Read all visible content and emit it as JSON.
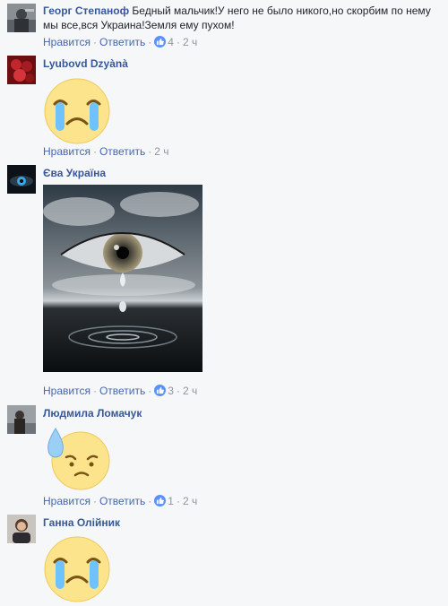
{
  "comments": [
    {
      "author": "Георг Степаноф",
      "text": "Бедный мальчик!У него не было никого,но скорбим по нему мы все,вся Украина!Земля ему пухом!",
      "like_label": "Нравится",
      "reply_label": "Ответить",
      "like_count": "4",
      "time": "2 ч"
    },
    {
      "author": "Lyubovd Dzyànà",
      "like_label": "Нравится",
      "reply_label": "Ответить",
      "time": "2 ч"
    },
    {
      "author": "Єва Україна",
      "like_label": "Нравится",
      "reply_label": "Ответить",
      "like_count": "3",
      "time": "2 ч"
    },
    {
      "author": "Людмила Ломачук",
      "like_label": "Нравится",
      "reply_label": "Ответить",
      "like_count": "1",
      "time": "2 ч"
    },
    {
      "author": "Ганна Олійник"
    }
  ],
  "icons": {
    "like_badge": "thumbs-up-icon",
    "crying_sticker": "crying-face-sticker",
    "sweat_sticker": "sad-sweat-face-sticker"
  },
  "colors": {
    "author_link": "#365899",
    "action_link": "#4267b2",
    "meta_gray": "#90949c",
    "like_badge": "#5890ff",
    "background": "#f6f7f9"
  }
}
